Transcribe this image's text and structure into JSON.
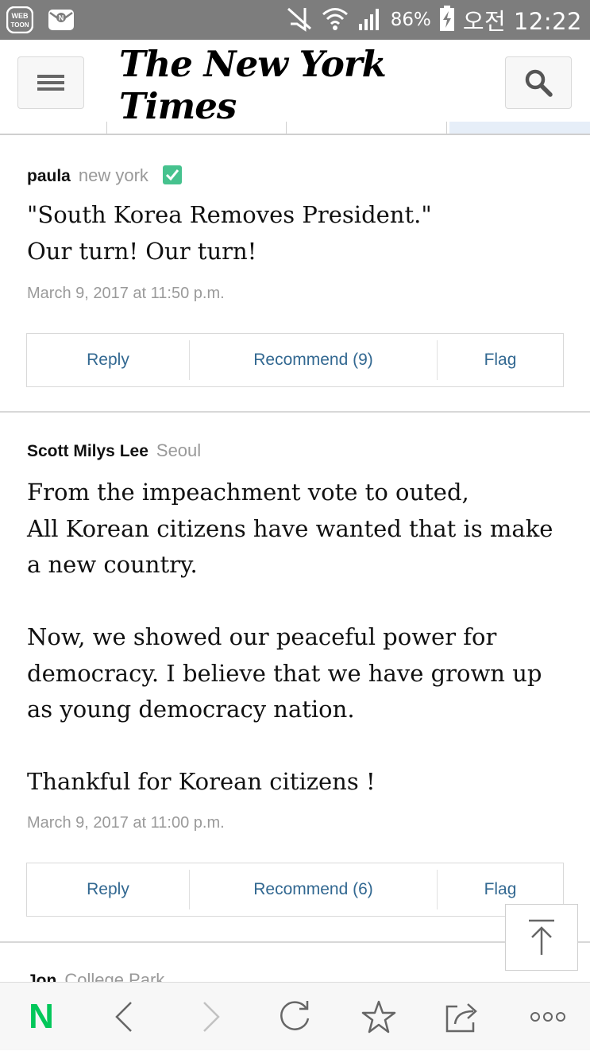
{
  "status_bar": {
    "app_icons": [
      "webtoon-app-icon",
      "naver-mail-icon"
    ],
    "webtoon_label_top": "WEB",
    "webtoon_label_bottom": "TOON",
    "battery_percent": "86%",
    "time": "오전 12:22",
    "icons": [
      "mute-icon",
      "wifi-icon",
      "signal-icon",
      "battery-charging-icon"
    ]
  },
  "header": {
    "logo": "The New York Times",
    "menu_icon": "hamburger-menu-icon",
    "search_icon": "search-icon"
  },
  "comments": [
    {
      "author": "paula",
      "location": "new york",
      "verified": true,
      "body": "\"South Korea Removes President.\"\nOur turn! Our turn!",
      "date": "March 9, 2017 at 11:50 p.m.",
      "reply_label": "Reply",
      "recommend_label": "Recommend (9)",
      "flag_label": "Flag"
    },
    {
      "author": "Scott Milys Lee",
      "location": "Seoul",
      "verified": false,
      "body": "From the impeachment vote to outed,\nAll Korean citizens have wanted that is make a new country.\n\nNow, we showed our peaceful power for democracy. I believe that we have grown up as young democracy nation.\n\nThankful for Korean citizens !",
      "date": "March 9, 2017 at 11:00 p.m.",
      "reply_label": "Reply",
      "recommend_label": "Recommend (6)",
      "flag_label": "Flag"
    },
    {
      "author": "Jon",
      "location": "College Park"
    }
  ],
  "back_to_top_icon": "arrow-up-to-top-icon",
  "bottom_nav": {
    "logo_letter": "N",
    "brand_color": "#03c75a",
    "icons": [
      "naver-home-icon",
      "back-icon",
      "forward-icon",
      "refresh-icon",
      "bookmark-star-icon",
      "share-icon",
      "more-icon"
    ]
  },
  "colors": {
    "link": "#326891",
    "verified": "#46c28e",
    "status_bar": "#7d7d7d"
  }
}
